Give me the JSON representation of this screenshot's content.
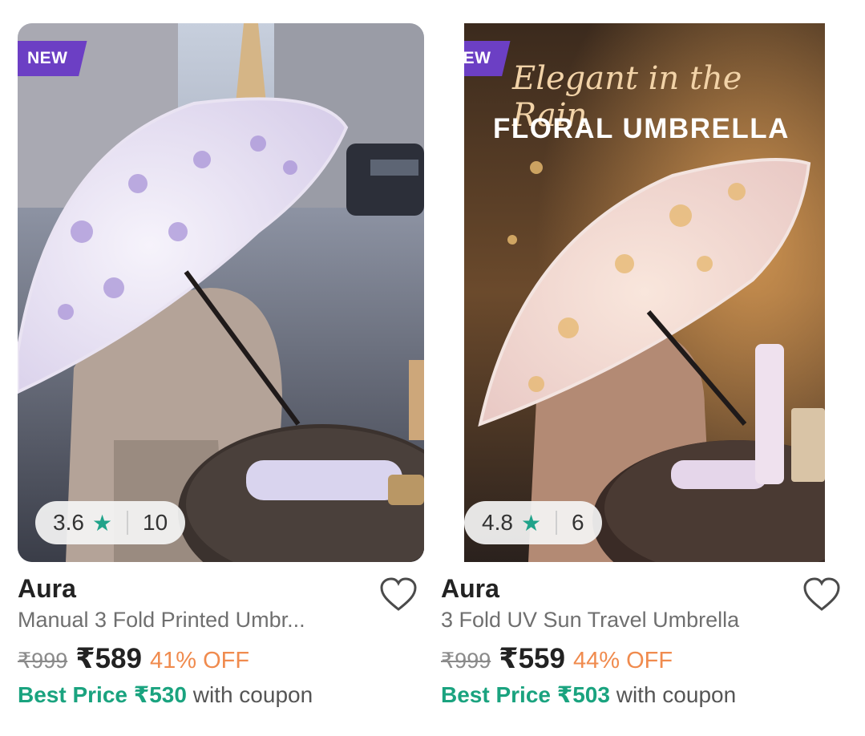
{
  "products": [
    {
      "badge": "NEW",
      "rating": "3.6",
      "rating_count": "10",
      "brand": "Aura",
      "title": "Manual 3 Fold Printed Umbr...",
      "mrp": "₹999",
      "price": "₹589",
      "discount": "41% OFF",
      "best_price_label": "Best Price ₹530",
      "coupon_suffix": " with coupon"
    },
    {
      "badge": "NEW",
      "overlay_script": "Elegant in the Rain",
      "overlay_title": "FLORAL UMBRELLA",
      "rating": "4.8",
      "rating_count": "6",
      "brand": "Aura",
      "title": "3 Fold UV Sun Travel Umbrella",
      "mrp": "₹999",
      "price": "₹559",
      "discount": "44% OFF",
      "best_price_label": "Best Price ₹503",
      "coupon_suffix": " with coupon"
    }
  ],
  "icons": {
    "rating": "star-icon",
    "wishlist": "heart-outline-icon"
  },
  "colors": {
    "badge": "#6c3fc4",
    "star": "#20a38a",
    "discount": "#f08b4e",
    "best_price": "#1aa37f"
  }
}
